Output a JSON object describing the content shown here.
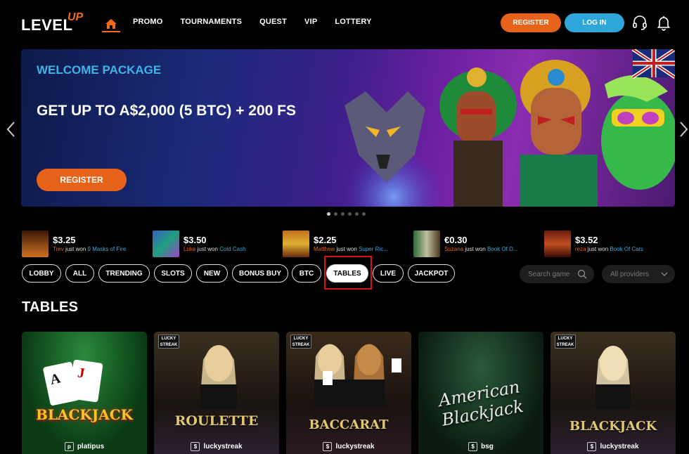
{
  "header": {
    "logo_main": "LEVEL",
    "logo_accent": "UP",
    "nav": [
      "PROMO",
      "TOURNAMENTS",
      "QUEST",
      "VIP",
      "LOTTERY"
    ],
    "register_label": "REGISTER",
    "login_label": "LOG IN",
    "support_icon": "headset-icon",
    "notification_icon": "bell-icon"
  },
  "banner": {
    "subtitle": "WELCOME PACKAGE",
    "headline": "GET UP TO A$2,000 (5 BTC) + 200 FS",
    "cta": "REGISTER",
    "slide_count": 6,
    "active_slide": 1
  },
  "winners": [
    {
      "amount": "$3.25",
      "user": "Trev",
      "text": "just won",
      "game": "9 Masks of Fire"
    },
    {
      "amount": "$3.50",
      "user": "Luke",
      "text": "just won",
      "game": "Cold Cash"
    },
    {
      "amount": "$2.25",
      "user": "Matthew",
      "text": "just won",
      "game": "Super Ric..."
    },
    {
      "amount": "€0.30",
      "user": "Suzana",
      "text": "just won",
      "game": "Book Of D..."
    },
    {
      "amount": "$3.52",
      "user": "reza",
      "text": "just won",
      "game": "Book Of Cats"
    }
  ],
  "filters": {
    "chips": [
      "LOBBY",
      "ALL",
      "TRENDING",
      "SLOTS",
      "NEW",
      "BONUS BUY",
      "BTC",
      "TABLES",
      "LIVE",
      "JACKPOT"
    ],
    "active": "TABLES",
    "search_placeholder": "Search game",
    "providers_label": "All providers"
  },
  "section": {
    "title": "TABLES"
  },
  "games": [
    {
      "title": "BLACKJACK",
      "provider": "platipus",
      "provider_icon": "p"
    },
    {
      "title": "ROULETTE",
      "provider": "luckystreak",
      "provider_icon": "$"
    },
    {
      "title": "BACCARAT",
      "provider": "luckystreak",
      "provider_icon": "$"
    },
    {
      "title": "American Blackjack",
      "provider": "bsg",
      "provider_icon": "$"
    },
    {
      "title": "BLACKJACK",
      "provider": "luckystreak",
      "provider_icon": "$"
    }
  ],
  "colors": {
    "accent_orange": "#e8631a",
    "accent_blue": "#2ea6d9",
    "highlight_red": "#d11111"
  }
}
